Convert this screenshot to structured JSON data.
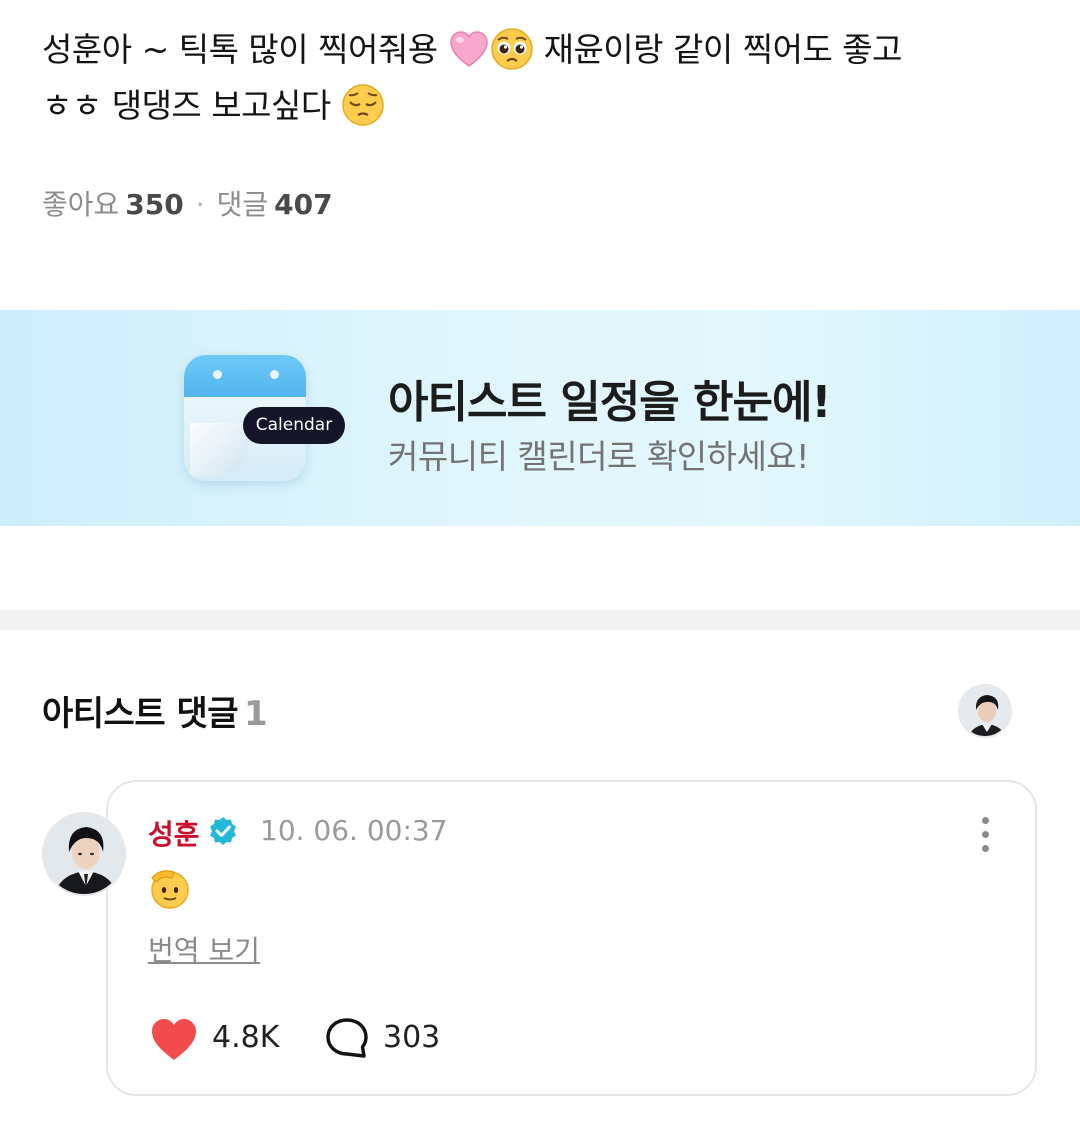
{
  "post": {
    "line1": "성훈아 ~ 틱톡 많이 찍어줘용",
    "line1_after": "재윤이랑 같이 찍어도 좋고",
    "line2": "ㅎㅎ 댕댕즈 보고싶다",
    "emoji_1": "pink-heart-emoji",
    "emoji_2": "pleading-face-emoji",
    "emoji_3": "pensive-face-emoji"
  },
  "stats": {
    "likes_label": "좋아요",
    "likes_count": "350",
    "separator": "·",
    "comments_label": "댓글",
    "comments_count": "407"
  },
  "banner": {
    "calendar_pill": "Calendar",
    "title": "아티스트 일정을 한눈에!",
    "subtitle": "커뮤니티 캘린더로 확인하세요!",
    "accent_color": "#52b5ee"
  },
  "artist_comments": {
    "title": "아티스트 댓글",
    "count": "1"
  },
  "comment": {
    "author": "성훈",
    "author_color": "#c8102e",
    "verified_icon": "verified-badge-icon",
    "timestamp": "10. 06. 00:37",
    "body_emoji": "saluting-face-emoji",
    "translate_label": "번역 보기",
    "likes": "4.8K",
    "replies": "303",
    "like_color": "#f24b4b"
  }
}
